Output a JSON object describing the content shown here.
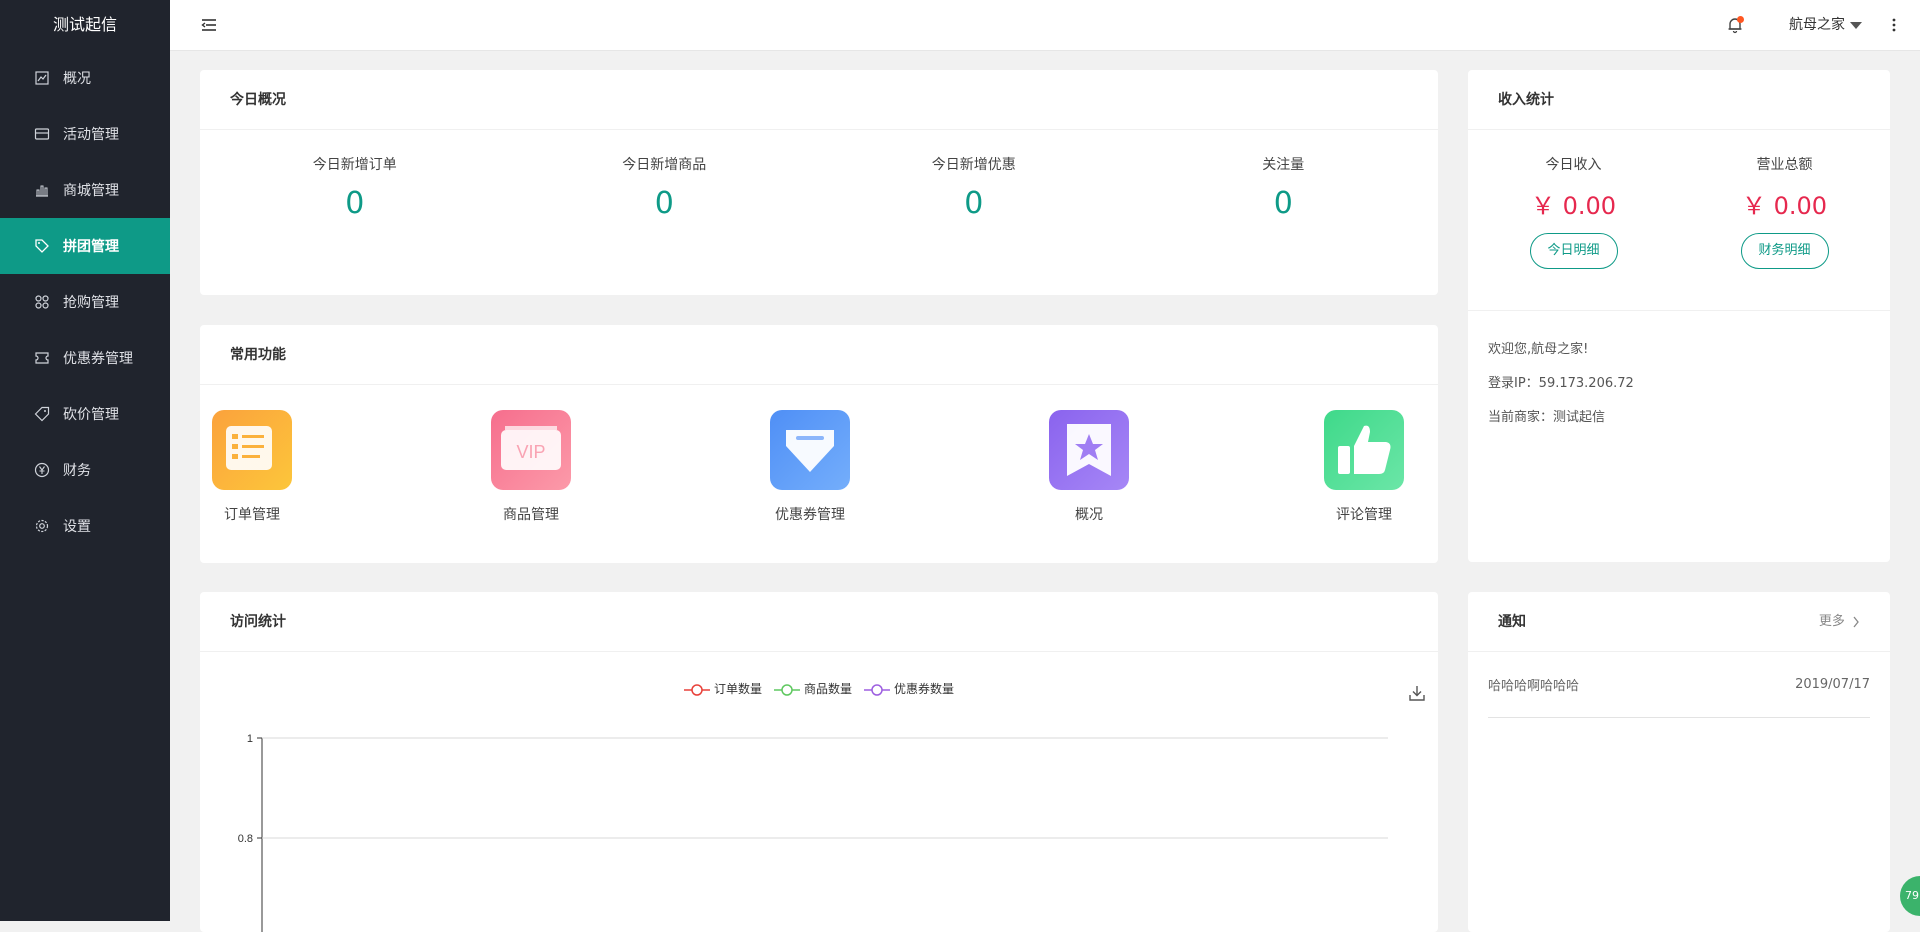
{
  "brand": "测试起信",
  "sidebar": {
    "items": [
      {
        "label": "概况",
        "icon": "overview-icon"
      },
      {
        "label": "活动管理",
        "icon": "activity-icon"
      },
      {
        "label": "商城管理",
        "icon": "bar-chart-icon"
      },
      {
        "label": "拼团管理",
        "icon": "tag-icon",
        "active": true
      },
      {
        "label": "抢购管理",
        "icon": "grid-icon"
      },
      {
        "label": "优惠券管理",
        "icon": "coupon-icon"
      },
      {
        "label": "砍价管理",
        "icon": "price-tag-icon"
      },
      {
        "label": "财务",
        "icon": "yen-icon"
      },
      {
        "label": "设置",
        "icon": "gear-icon"
      }
    ]
  },
  "header": {
    "user_name": "航母之家",
    "notification_dot_color": "#ff5722"
  },
  "overview": {
    "title": "今日概况",
    "stats": [
      {
        "label": "今日新增订单",
        "value": "0"
      },
      {
        "label": "今日新增商品",
        "value": "0"
      },
      {
        "label": "今日新增优惠",
        "value": "0"
      },
      {
        "label": "关注量",
        "value": "0"
      }
    ]
  },
  "income": {
    "title": "收入统计",
    "today_label": "今日收入",
    "today_value": "￥ 0.00",
    "today_button": "今日明细",
    "total_label": "营业总额",
    "total_value": "￥ 0.00",
    "total_button": "财务明细",
    "welcome": "欢迎您,航母之家!",
    "login_ip": "登录IP：59.173.206.72",
    "merchant": "当前商家：测试起信"
  },
  "functions": {
    "title": "常用功能",
    "items": [
      {
        "label": "订单管理",
        "icon": "order-list-icon",
        "colors": [
          "#fba23c",
          "#fcc63b"
        ]
      },
      {
        "label": "商品管理",
        "icon": "vip-card-icon",
        "colors": [
          "#f66e8d",
          "#fc9aa9"
        ]
      },
      {
        "label": "优惠券管理",
        "icon": "coupon-shield-icon",
        "colors": [
          "#4f8ff6",
          "#74aefb"
        ]
      },
      {
        "label": "概况",
        "icon": "star-bookmark-icon",
        "colors": [
          "#8a63ee",
          "#a687f6"
        ]
      },
      {
        "label": "评论管理",
        "icon": "thumbs-up-icon",
        "colors": [
          "#3fd98a",
          "#6be6a7"
        ]
      }
    ]
  },
  "visits": {
    "title": "访问统计"
  },
  "chart_data": {
    "type": "line",
    "title": "",
    "series": [
      {
        "name": "订单数量",
        "color": "#e8413a",
        "values": []
      },
      {
        "name": "商品数量",
        "color": "#5fc860",
        "values": []
      },
      {
        "name": "优惠券数量",
        "color": "#9d5fe0",
        "values": []
      }
    ],
    "y_ticks": [
      "1",
      "0.8"
    ],
    "ylim": [
      0,
      1
    ],
    "grid": true,
    "legend": "top-center"
  },
  "notice": {
    "title": "通知",
    "more_label": "更多",
    "items": [
      {
        "text": "哈哈哈啊哈哈哈",
        "date": "2019/07/17"
      }
    ]
  },
  "float_badge": "79"
}
